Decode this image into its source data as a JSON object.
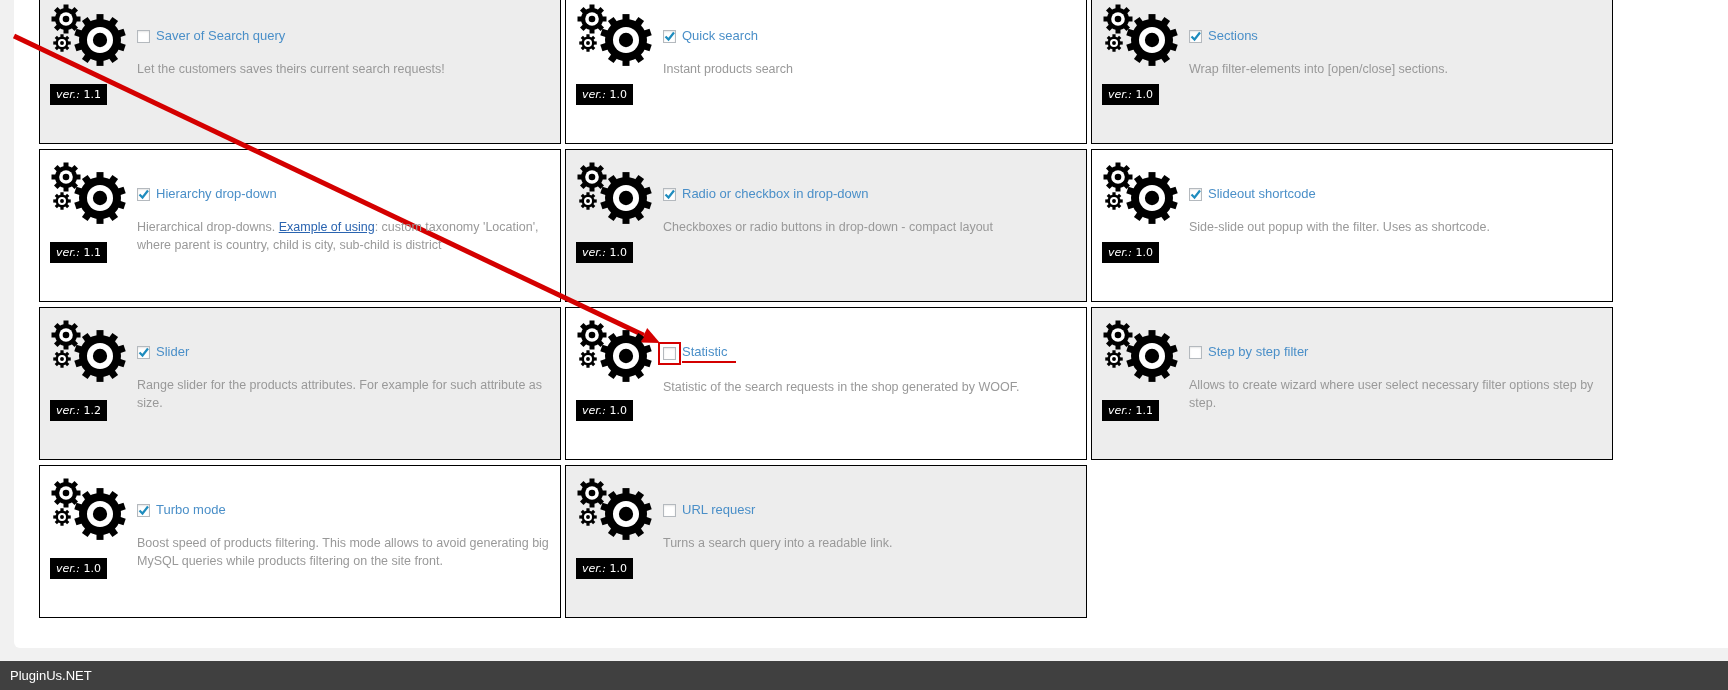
{
  "extensions": [
    {
      "title": "Saver of Search query",
      "checked": false,
      "highlighted": false,
      "description": [
        {
          "kind": "text",
          "text": "Let the customers saves theirs current search requests!"
        }
      ],
      "version": "*ver.:* 1.1"
    },
    {
      "title": "Quick search",
      "checked": true,
      "highlighted": false,
      "description": [
        {
          "kind": "text",
          "text": "Instant products search"
        }
      ],
      "version": "*ver.:* 1.0"
    },
    {
      "title": "Sections",
      "checked": true,
      "highlighted": false,
      "description": [
        {
          "kind": "text",
          "text": "Wrap filter-elements into [open/close] sections."
        }
      ],
      "version": "*ver.:* 1.0"
    },
    {
      "title": "Hierarchy drop-down",
      "checked": true,
      "highlighted": false,
      "description": [
        {
          "kind": "text",
          "text": "Hierarchical drop-downs. "
        },
        {
          "kind": "link",
          "text": "Example of using"
        },
        {
          "kind": "text",
          "text": ": custom taxonomy 'Location', where parent is country, child is city, sub-child is district"
        }
      ],
      "version": "*ver.:* 1.1"
    },
    {
      "title": "Radio or checkbox in drop-down",
      "checked": true,
      "highlighted": false,
      "description": [
        {
          "kind": "text",
          "text": "Checkboxes or radio buttons in drop-down - compact layout"
        }
      ],
      "version": "*ver.:* 1.0"
    },
    {
      "title": "Slideout shortcode",
      "checked": true,
      "highlighted": false,
      "description": [
        {
          "kind": "text",
          "text": "Side-slide out popup with the filter. Uses as shortcode."
        }
      ],
      "version": "*ver.:* 1.0"
    },
    {
      "title": "Slider",
      "checked": true,
      "highlighted": false,
      "description": [
        {
          "kind": "text",
          "text": "Range slider for the products attributes. For example for such attribute as size."
        }
      ],
      "version": "*ver.:* 1.2"
    },
    {
      "title": "Statistic",
      "checked": false,
      "highlighted": true,
      "description": [
        {
          "kind": "text",
          "text": "Statistic of the search requests in the shop generated by WOOF."
        }
      ],
      "version": "*ver.:* 1.0"
    },
    {
      "title": "Step by step filter",
      "checked": false,
      "highlighted": false,
      "description": [
        {
          "kind": "text",
          "text": "Allows to create wizard where user select necessary filter options step by step."
        }
      ],
      "version": "*ver.:* 1.1"
    },
    {
      "title": "Turbo mode",
      "checked": true,
      "highlighted": false,
      "description": [
        {
          "kind": "text",
          "text": "Boost speed of products filtering. This mode allows to avoid generating big MySQL queries while products filtering on the site front."
        }
      ],
      "version": "*ver.:* 1.0"
    },
    {
      "title": "URL requesr",
      "checked": false,
      "highlighted": false,
      "description": [
        {
          "kind": "text",
          "text": "Turns a search query into a readable link."
        }
      ],
      "version": "*ver.:* 1.0"
    }
  ],
  "footer": {
    "brand": "PluginUs.NET"
  }
}
